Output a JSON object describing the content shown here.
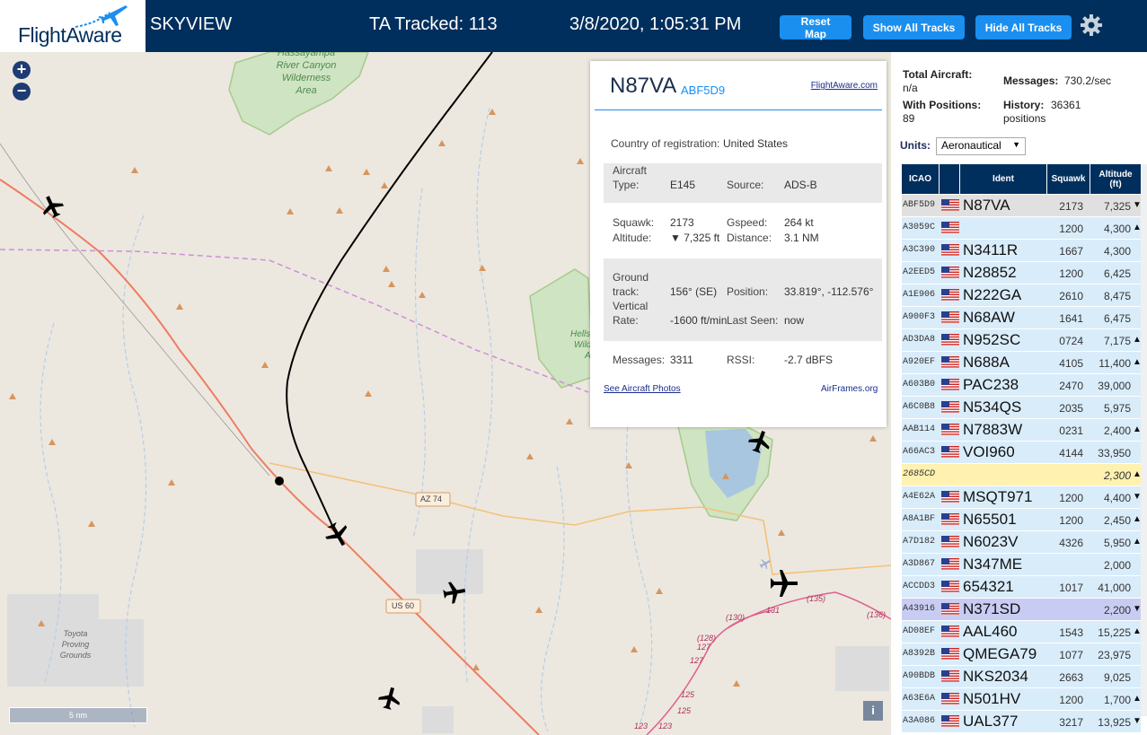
{
  "header": {
    "logo_text": "FlightAware",
    "app_title": "SKYVIEW",
    "tracked": "TA Tracked: 113",
    "datetime": "3/8/2020, 1:05:31 PM",
    "reset_map": "Reset Map",
    "show_all_tracks": "Show All Tracks",
    "hide_all_tracks": "Hide All Tracks"
  },
  "map": {
    "zoom_in": "+",
    "zoom_out": "−",
    "labels": {
      "wilderness": "Hassayampa River Canyon Wilderness Area",
      "wilderness_lines": [
        "Hassayampa",
        "River Canyon",
        "Wilderness",
        "Area"
      ],
      "hells": "Hells",
      "wild": "Wild",
      "wild_a": "A",
      "toyota_lines": [
        "Toyota",
        "Proving",
        "Grounds"
      ],
      "az74": "AZ 74",
      "us60": "US 60",
      "r130": "(130)",
      "r131": "131",
      "r135": "(135)",
      "r136": "(136)",
      "r128": "(128)",
      "r127a": "127",
      "r127b": "127",
      "r125a": "125",
      "r125b": "125",
      "r123a": "123",
      "r123b": "123"
    },
    "scale": "5 nm",
    "info": "i"
  },
  "popup": {
    "ident": "N87VA",
    "icao": "ABF5D9",
    "fa_link": "FlightAware.com",
    "country_label": "Country of registration:",
    "country": "United States",
    "aircraft_type_label_1": "Aircraft",
    "aircraft_type_label_2": "Type:",
    "aircraft_type": "E145",
    "source_label": "Source:",
    "source": "ADS-B",
    "squawk_label": "Squawk:",
    "squawk": "2173",
    "gspeed_label": "Gspeed:",
    "gspeed": "264 kt",
    "altitude_label": "Altitude:",
    "altitude": "▼ 7,325 ft",
    "distance_label": "Distance:",
    "distance": "3.1 NM",
    "ground_track_label_1": "Ground",
    "ground_track_label_2": "track:",
    "ground_track": "156° (SE)",
    "position_label": "Position:",
    "position": "33.819°, -112.576°",
    "vrate_label_1": "Vertical",
    "vrate_label_2": "Rate:",
    "vrate": "-1600 ft/min",
    "last_seen_label": "Last Seen:",
    "last_seen": "now",
    "messages_label": "Messages:",
    "messages": "3311",
    "rssi_label": "RSSI:",
    "rssi": "-2.7 dBFS",
    "photos_link": "See Aircraft Photos",
    "airframes_link": "AirFrames.org"
  },
  "sidebar": {
    "total_aircraft_label": "Total Aircraft:",
    "total_aircraft": "n/a",
    "messages_label": "Messages:",
    "messages": "730.2/sec",
    "with_positions_label": "With Positions:",
    "with_positions": "89",
    "history_label": "History:",
    "history": "36361",
    "history_unit": "positions",
    "units_label": "Units:",
    "units_value": "Aeronautical",
    "columns": {
      "icao": "ICAO",
      "ident": "Ident",
      "squawk": "Squawk",
      "altitude_1": "Altitude",
      "altitude_2": "(ft)"
    },
    "rows": [
      {
        "icao": "ABF5D9",
        "flag": true,
        "ident": "N87VA",
        "squawk": "2173",
        "alt": "7,325",
        "arrow": "▼",
        "style": "sel"
      },
      {
        "icao": "A3059C",
        "flag": true,
        "ident": "",
        "squawk": "1200",
        "alt": "4,300",
        "arrow": "▲",
        "style": ""
      },
      {
        "icao": "A3C390",
        "flag": true,
        "ident": "N3411R",
        "squawk": "1667",
        "alt": "4,300",
        "arrow": "",
        "style": ""
      },
      {
        "icao": "A2EED5",
        "flag": true,
        "ident": "N28852",
        "squawk": "1200",
        "alt": "6,425",
        "arrow": "",
        "style": ""
      },
      {
        "icao": "A1E906",
        "flag": true,
        "ident": "N222GA",
        "squawk": "2610",
        "alt": "8,475",
        "arrow": "",
        "style": ""
      },
      {
        "icao": "A900F3",
        "flag": true,
        "ident": "N68AW",
        "squawk": "1641",
        "alt": "6,475",
        "arrow": "",
        "style": ""
      },
      {
        "icao": "AD3DA8",
        "flag": true,
        "ident": "N952SC",
        "squawk": "0724",
        "alt": "7,175",
        "arrow": "▲",
        "style": ""
      },
      {
        "icao": "A920EF",
        "flag": true,
        "ident": "N688A",
        "squawk": "4105",
        "alt": "11,400",
        "arrow": "▲",
        "style": ""
      },
      {
        "icao": "A603B0",
        "flag": true,
        "ident": "PAC238",
        "squawk": "2470",
        "alt": "39,000",
        "arrow": "",
        "style": ""
      },
      {
        "icao": "A6C0B8",
        "flag": true,
        "ident": "N534QS",
        "squawk": "2035",
        "alt": "5,975",
        "arrow": "",
        "style": ""
      },
      {
        "icao": "AAB114",
        "flag": true,
        "ident": "N7883W",
        "squawk": "0231",
        "alt": "2,400",
        "arrow": "▲",
        "style": ""
      },
      {
        "icao": "A66AC3",
        "flag": true,
        "ident": "VOI960",
        "squawk": "4144",
        "alt": "33,950",
        "arrow": "",
        "style": ""
      },
      {
        "icao": "2685CD",
        "flag": false,
        "ident": "",
        "squawk": "",
        "alt": "2,300",
        "arrow": "▲",
        "style": "yel"
      },
      {
        "icao": "A4E62A",
        "flag": true,
        "ident": "MSQT971",
        "squawk": "1200",
        "alt": "4,400",
        "arrow": "▼",
        "style": ""
      },
      {
        "icao": "A8A1BF",
        "flag": true,
        "ident": "N65501",
        "squawk": "1200",
        "alt": "2,450",
        "arrow": "▲",
        "style": ""
      },
      {
        "icao": "A7D182",
        "flag": true,
        "ident": "N6023V",
        "squawk": "4326",
        "alt": "5,950",
        "arrow": "▲",
        "style": ""
      },
      {
        "icao": "A3D867",
        "flag": true,
        "ident": "N347ME",
        "squawk": "",
        "alt": "2,000",
        "arrow": "",
        "style": ""
      },
      {
        "icao": "ACCDD3",
        "flag": true,
        "ident": "654321",
        "squawk": "1017",
        "alt": "41,000",
        "arrow": "",
        "style": ""
      },
      {
        "icao": "A43916",
        "flag": true,
        "ident": "N371SD",
        "squawk": "",
        "alt": "2,200",
        "arrow": "▼",
        "style": "lav"
      },
      {
        "icao": "AD08EF",
        "flag": true,
        "ident": "AAL460",
        "squawk": "1543",
        "alt": "15,225",
        "arrow": "▲",
        "style": ""
      },
      {
        "icao": "A8392B",
        "flag": true,
        "ident": "QMEGA79",
        "squawk": "1077",
        "alt": "23,975",
        "arrow": "",
        "style": ""
      },
      {
        "icao": "A90BDB",
        "flag": true,
        "ident": "NKS2034",
        "squawk": "2663",
        "alt": "9,025",
        "arrow": "",
        "style": ""
      },
      {
        "icao": "A63E6A",
        "flag": true,
        "ident": "N501HV",
        "squawk": "1200",
        "alt": "1,700",
        "arrow": "▲",
        "style": ""
      },
      {
        "icao": "A3A086",
        "flag": true,
        "ident": "UAL377",
        "squawk": "3217",
        "alt": "13,925",
        "arrow": "▼",
        "style": ""
      }
    ]
  },
  "colors": {
    "header_bg": "#002f5d",
    "button_blue": "#1a8ff0",
    "row_bg": "#d9ecfa",
    "selected_row": "#e0e0e0",
    "mlat_row": "#fff1b0",
    "highlight_row": "#c9ccf2",
    "track_line": "#000000",
    "highway": "#f07c63"
  }
}
